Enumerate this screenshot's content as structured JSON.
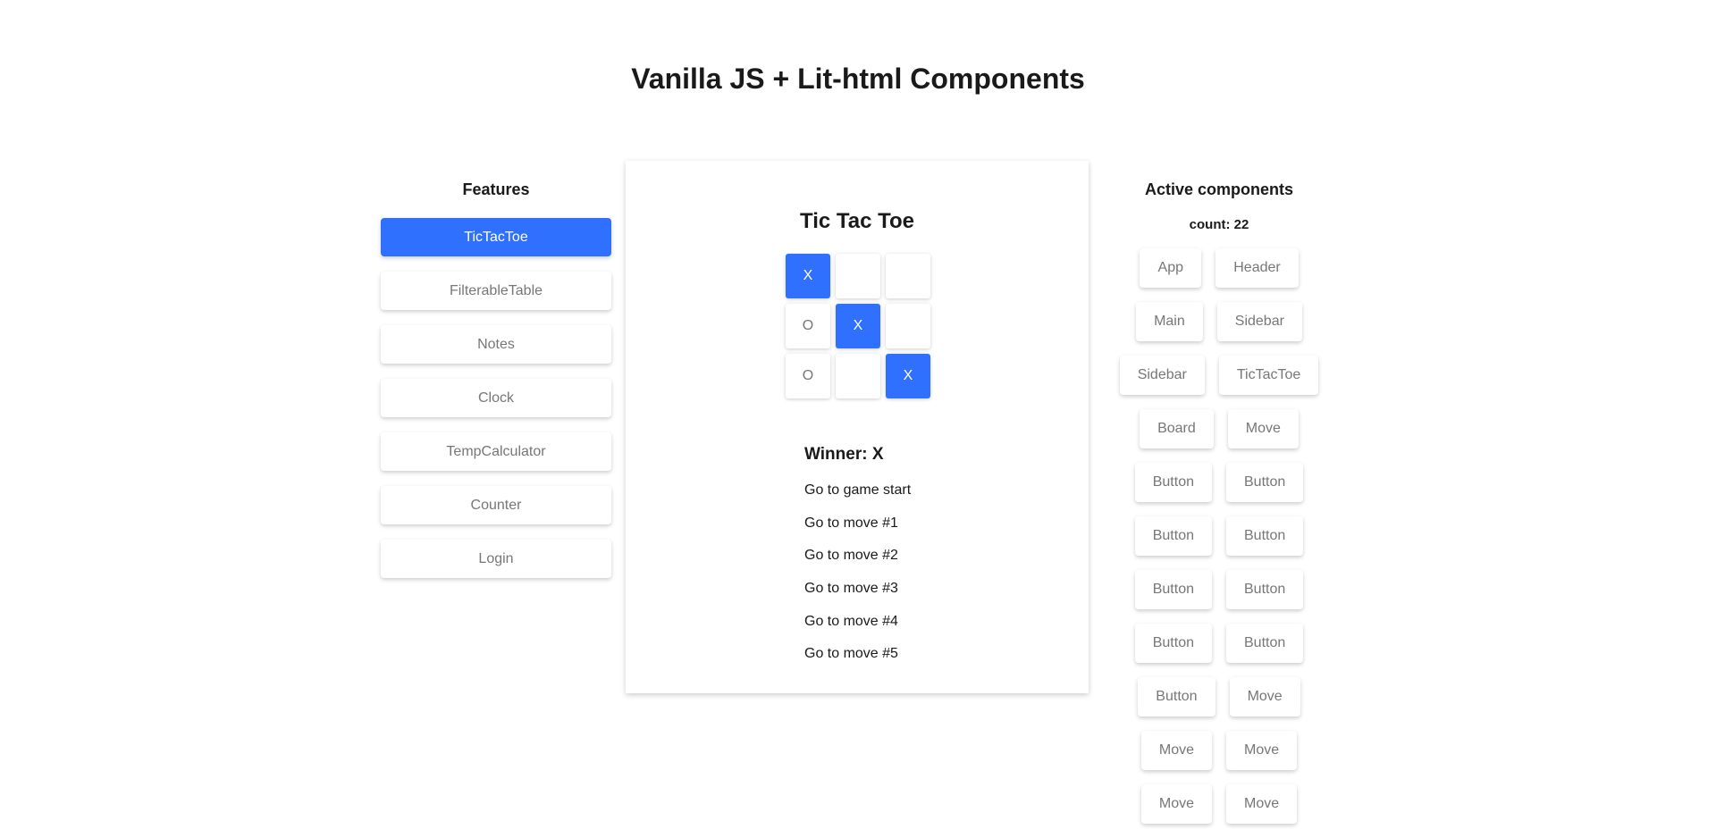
{
  "header": {
    "title": "Vanilla JS + Lit-html Components"
  },
  "sidebar": {
    "title": "Features",
    "items": [
      {
        "label": "TicTacToe",
        "active": true
      },
      {
        "label": "FilterableTable"
      },
      {
        "label": "Notes"
      },
      {
        "label": "Clock"
      },
      {
        "label": "TempCalculator"
      },
      {
        "label": "Counter"
      },
      {
        "label": "Login"
      }
    ]
  },
  "game": {
    "title": "Tic Tac Toe",
    "board": [
      "X",
      "",
      "",
      "O",
      "X",
      "",
      "O",
      "",
      "X"
    ],
    "status": "Winner: X",
    "moves": [
      "Go to game start",
      "Go to move #1",
      "Go to move #2",
      "Go to move #3",
      "Go to move #4",
      "Go to move #5"
    ]
  },
  "active_components": {
    "title": "Active components",
    "count": "count: 22",
    "rows": [
      [
        "App",
        "Header"
      ],
      [
        "Main",
        "Sidebar"
      ],
      [
        "Sidebar",
        "TicTacToe"
      ],
      [
        "Board",
        "Move"
      ],
      [
        "Button",
        "Button"
      ],
      [
        "Button",
        "Button"
      ],
      [
        "Button",
        "Button"
      ],
      [
        "Button",
        "Button"
      ],
      [
        "Button",
        "Move"
      ],
      [
        "Move",
        "Move"
      ],
      [
        "Move",
        "Move"
      ]
    ]
  },
  "colors": {
    "accent": "#3070ff"
  }
}
